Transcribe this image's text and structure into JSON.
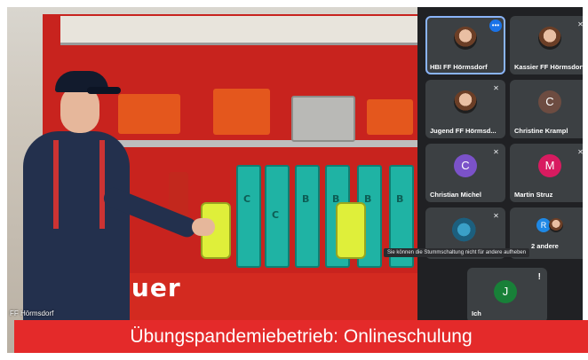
{
  "main_video": {
    "participant_name": "FF Hörmsdorf",
    "truck_text": "auer",
    "hose_letters": [
      "C",
      "C",
      "B",
      "B",
      "B",
      "B"
    ]
  },
  "tiles": [
    {
      "name": "HBI FF Hörmsdorf",
      "avatar_type": "photo",
      "active": true,
      "more": "•••"
    },
    {
      "name": "Kassier FF Hörmsdorf",
      "avatar_type": "photo",
      "mic_off": true
    },
    {
      "name": "Jugend FF Hörmsd...",
      "avatar_type": "photo",
      "mic_off": true
    },
    {
      "name": "Christine Krampl",
      "avatar_letter": "C",
      "avatar_color": "#6d4c41"
    },
    {
      "name": "Christian Michel",
      "avatar_letter": "C",
      "avatar_color": "#7b52c9",
      "mic_off": true
    },
    {
      "name": "Martin Struz",
      "avatar_letter": "M",
      "avatar_color": "#d81b60",
      "mic_off": true
    },
    {
      "name": "",
      "avatar_type": "image",
      "mic_off": true
    },
    {
      "name": "2 andere",
      "avatar_letter": "R",
      "avatar_color": "#1e88e5"
    },
    {
      "name": "Ich",
      "avatar_letter": "J",
      "avatar_color": "#188038",
      "alert": "!"
    }
  ],
  "tooltip": "Sie können die Stummschaltung nicht für andere aufheben",
  "banner": "Übungspandemiebetrieb: Onlineschulung",
  "icons": {
    "mic_off": "mic-off-icon",
    "more": "more-options-icon"
  },
  "colors": {
    "banner": "#e42a2a",
    "tile_bg": "#3c4043",
    "active_outline": "#8ab4f8"
  }
}
